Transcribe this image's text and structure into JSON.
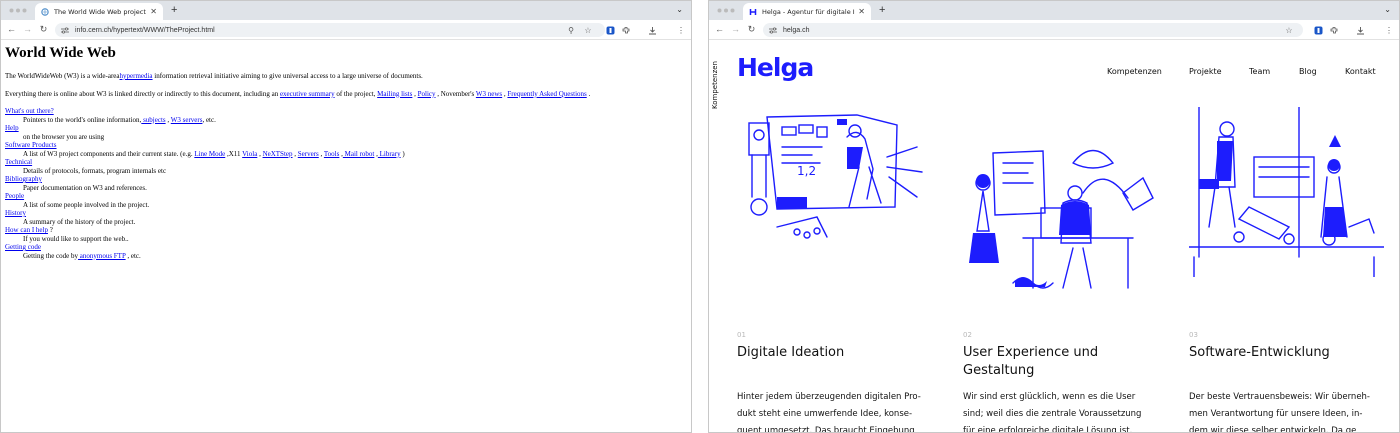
{
  "left_window": {
    "tab": {
      "title": "The World Wide Web project"
    },
    "address": {
      "url": "info.cern.ch/hypertext/WWW/TheProject.html"
    },
    "page": {
      "title": "World Wide Web",
      "intro": {
        "pre": "The WorldWideWeb (W3) is a wide-area",
        "link": "hypermedia",
        "post": " information retrieval initiative aiming to give universal access to a large universe of documents."
      },
      "everything": {
        "t1": "Everything there is online about W3 is linked directly or indirectly to this document, including an ",
        "l1": "executive summary",
        "t2": " of the project, ",
        "l2": "Mailing lists",
        "t3": " , ",
        "l3": "Policy",
        "t4": " , November's ",
        "l4": "W3 news",
        "t5": " , ",
        "l5": "Frequently Asked Questions",
        "t6": " ."
      },
      "items": {
        "whats_out": {
          "label": "What's out there?",
          "d1": "Pointers to the world's online information,",
          "l1": " subjects",
          "d2": " , ",
          "l2": "W3 servers",
          "d3": ", etc."
        },
        "help": {
          "label": "Help",
          "desc": "on the browser you are using"
        },
        "software": {
          "label": "Software Products",
          "d1": "A list of W3 project components and their current state. (e.g. ",
          "l1": "Line Mode",
          "d2": " ,X11 ",
          "l2": "Viola",
          "d3": " , ",
          "l3": "NeXTStep",
          "d4": " , ",
          "l4": "Servers",
          "d5": " , ",
          "l5": "Tools",
          "d6": " ,",
          "l6": " Mail robot",
          "d7": " ,",
          "l7": " Library",
          "d8": " )"
        },
        "technical": {
          "label": "Technical",
          "desc": "Details of protocols, formats, program internals etc"
        },
        "bibliography": {
          "label": "Bibliography",
          "desc": "Paper documentation on W3 and references."
        },
        "people": {
          "label": "People",
          "desc": "A list of some people involved in the project."
        },
        "history": {
          "label": "History",
          "desc": "A summary of the history of the project."
        },
        "how_help": {
          "label": "How can I help",
          "suffix": " ?",
          "desc": "If you would like to support the web.."
        },
        "getting_code": {
          "label": "Getting code",
          "d1": "Getting the code by",
          "l1": " anonymous FTP",
          "d2": " , etc."
        }
      }
    }
  },
  "right_window": {
    "tab": {
      "title": "Helga - Agentur für digitale Id"
    },
    "address": {
      "url": "helga.ch"
    },
    "page": {
      "side_label": "Kompetenzen",
      "logo": "Helga",
      "nav": [
        "Kompetenzen",
        "Projekte",
        "Team",
        "Blog",
        "Kontakt"
      ],
      "columns": [
        {
          "num": "01",
          "title": "Digitale Ideation",
          "body": "Hinter jedem überzeugenden digitalen Pro- dukt steht eine umwerfende Idee, konse- quent umgesetzt. Das braucht Eingebung"
        },
        {
          "num": "02",
          "title": "User Experience und Gestaltung",
          "body": "Wir sind erst glücklich, wenn es die User sind; weil dies die zentrale Voraussetzung für eine erfolgreiche digitale Lösung ist."
        },
        {
          "num": "03",
          "title": "Software-Entwicklung",
          "body": "Der beste Vertrauensbeweis: Wir überneh- men Verantwortung für unsere Ideen, in- dem wir diese selber entwickeln. Da ge"
        }
      ]
    }
  },
  "colors": {
    "link": "#0000ee",
    "helga_blue": "#1d1dfd",
    "tabbar": "#dfe3e8"
  }
}
